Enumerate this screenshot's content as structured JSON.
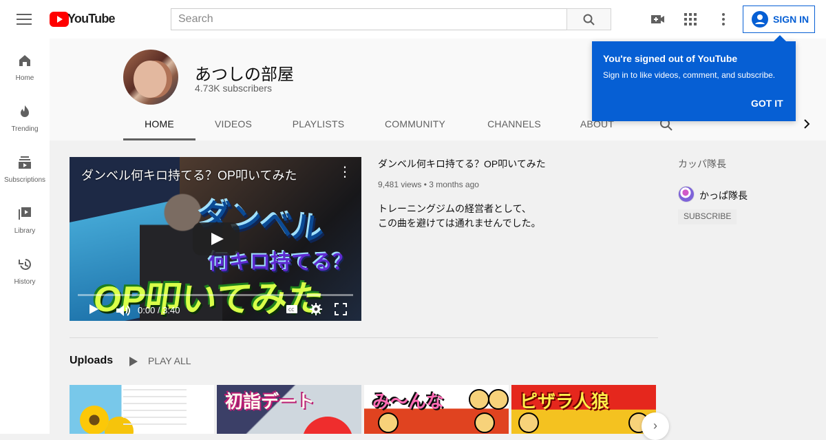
{
  "header": {
    "logo_label": "YouTube",
    "search_placeholder": "Search",
    "signin_label": "SIGN IN"
  },
  "sidebar": {
    "items": [
      {
        "label": "Home"
      },
      {
        "label": "Trending"
      },
      {
        "label": "Subscriptions"
      },
      {
        "label": "Library"
      },
      {
        "label": "History"
      }
    ]
  },
  "channel": {
    "name": "あつしの部屋",
    "subscribers": "4.73K subscribers",
    "tabs": [
      "HOME",
      "VIDEOS",
      "PLAYLISTS",
      "COMMUNITY",
      "CHANNELS",
      "ABOUT"
    ],
    "active_tab": "HOME"
  },
  "video": {
    "title": "ダンベル何キロ持てる？OP叩いてみた",
    "time": "0:00 / 3:40",
    "thumbnail_text_1": "ダンベル",
    "thumbnail_text_2": "何キロ持てる？",
    "thumbnail_text_3": "OP叩いてみた",
    "info_title": "ダンベル何キロ持てる？OP叩いてみた",
    "meta": "9,481 views • 3 months ago",
    "description": "トレーニングジムの経営者として、\nこの曲を避けては通れませんでした。"
  },
  "uploads": {
    "title": "Uploads",
    "play_all": "PLAY ALL",
    "thumbs": [
      "",
      "初詣デート",
      "み～んな",
      "ピザラ人狼"
    ]
  },
  "related": {
    "title": "カッパ隊長",
    "channel_name": "かっぱ隊長",
    "subscribe": "SUBSCRIBE"
  },
  "popup": {
    "title": "You're signed out of YouTube",
    "text": "Sign in to like videos, comment, and subscribe.",
    "button": "GOT IT"
  },
  "colors": {
    "brand_red": "#ff0000",
    "accent_blue": "#065fd4"
  }
}
